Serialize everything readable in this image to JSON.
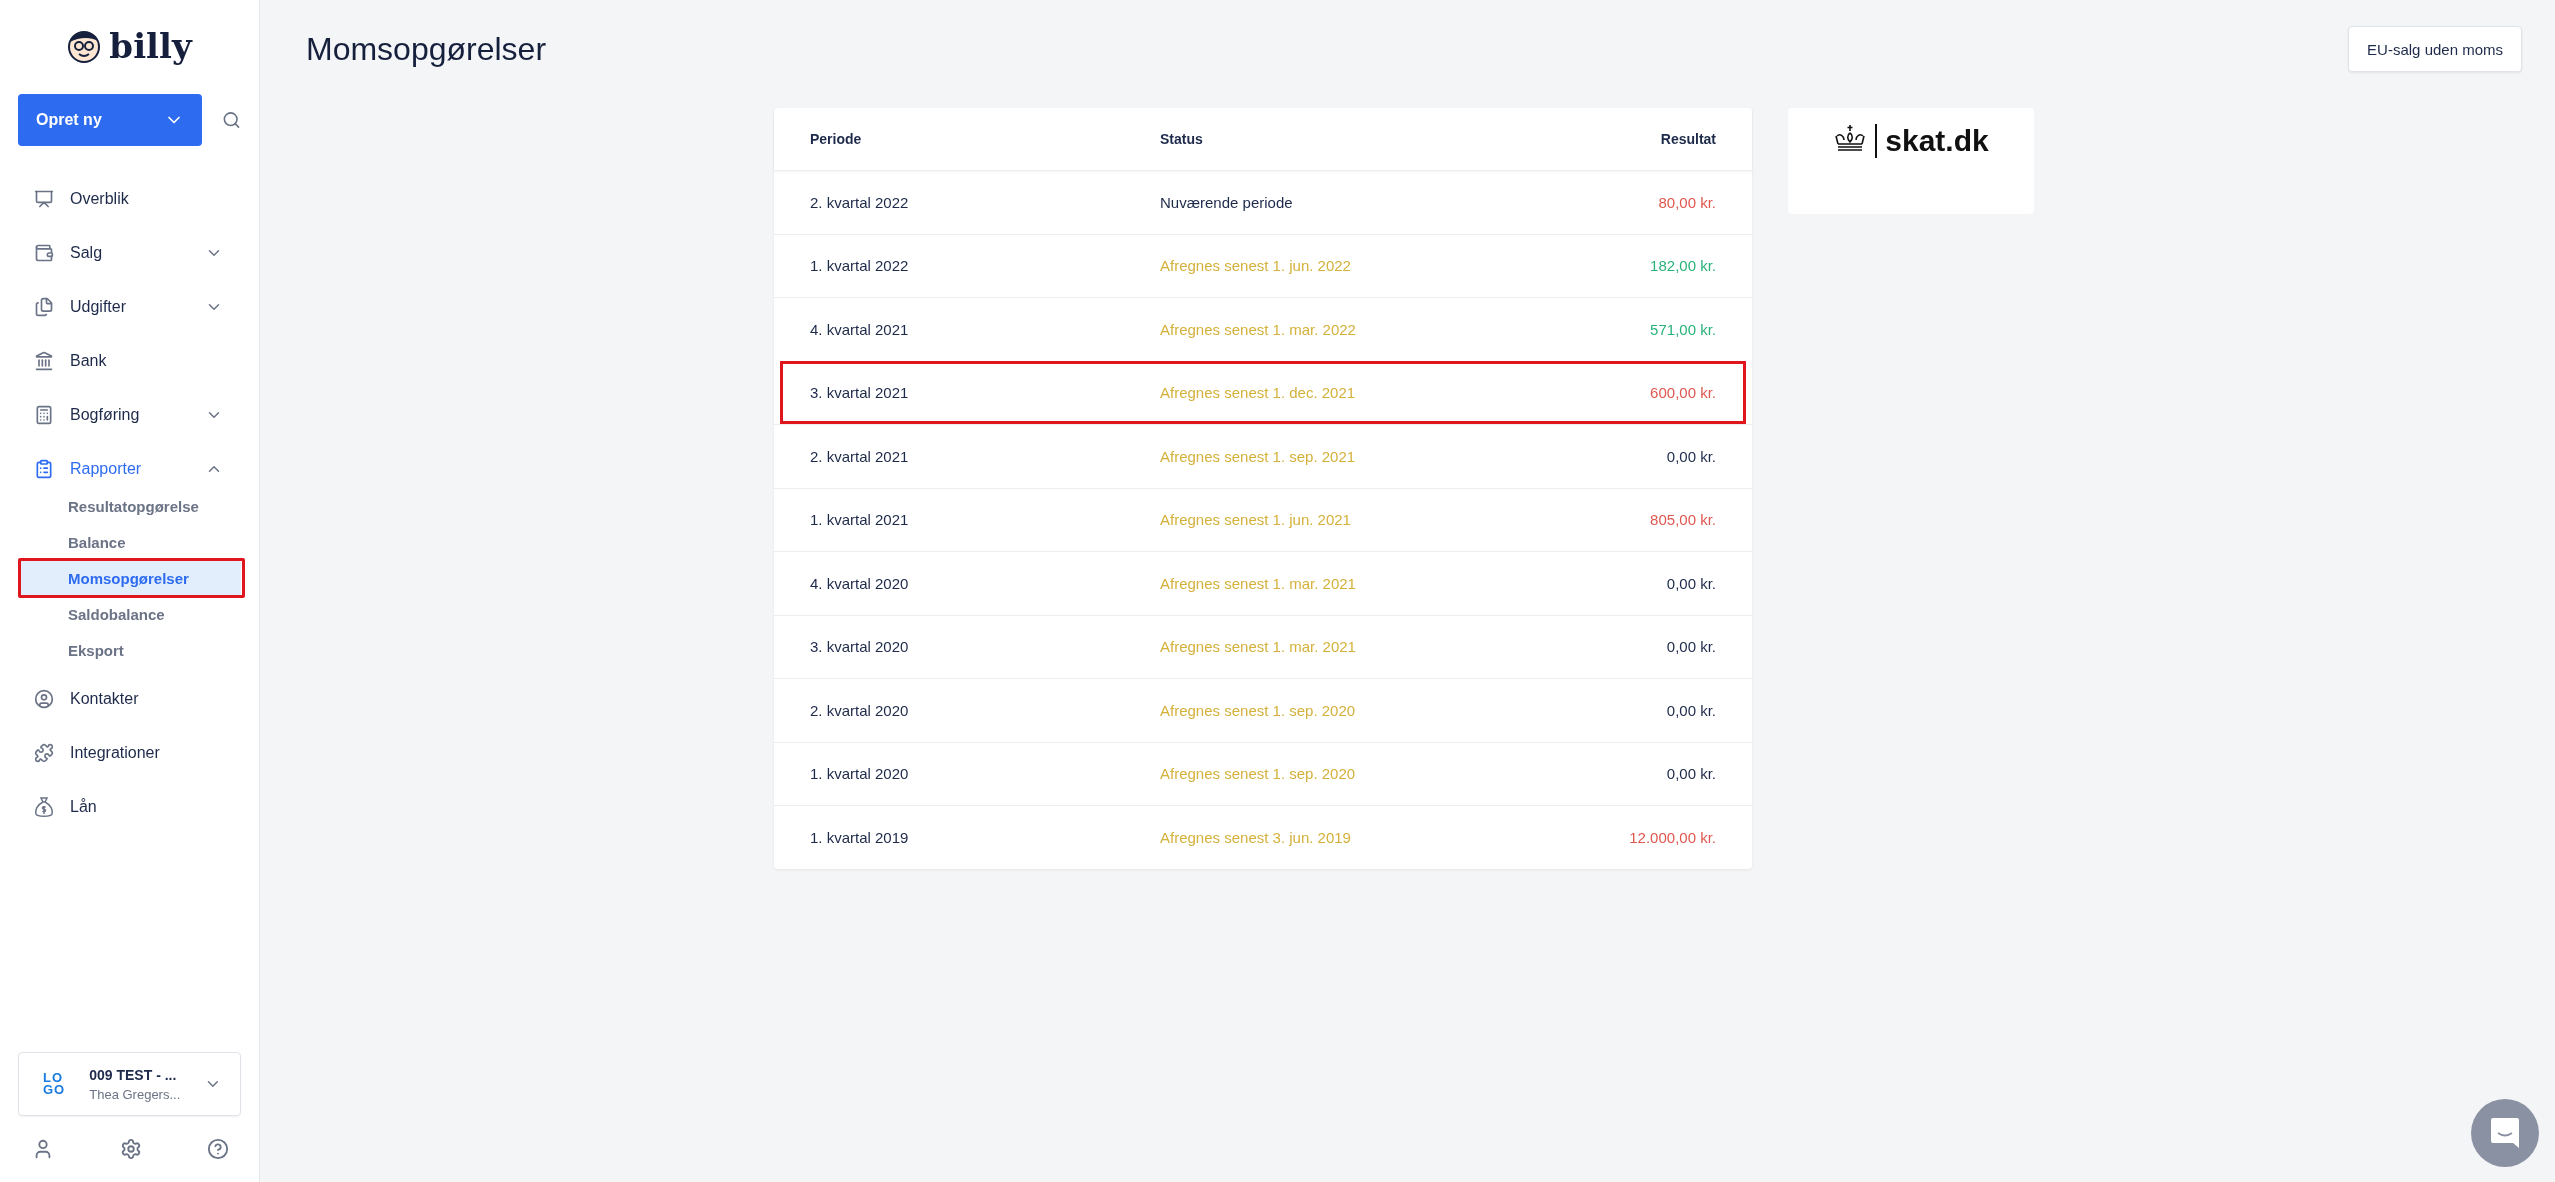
{
  "sidebar": {
    "brand": "billy",
    "create_button": "Opret ny",
    "items": [
      {
        "label": "Overblik",
        "selected": false
      },
      {
        "label": "Salg",
        "selected": false,
        "expanded": false
      },
      {
        "label": "Udgifter",
        "selected": false,
        "expanded": false
      },
      {
        "label": "Bank",
        "selected": false
      },
      {
        "label": "Bogføring",
        "selected": false,
        "expanded": false
      },
      {
        "label": "Rapporter",
        "selected": true,
        "expanded": true,
        "children": [
          {
            "label": "Resultatopgørelse",
            "selected": false,
            "highlighted": false
          },
          {
            "label": "Balance",
            "selected": false,
            "highlighted": false
          },
          {
            "label": "Momsopgørelser",
            "selected": true,
            "highlighted": true
          },
          {
            "label": "Saldobalance",
            "selected": false,
            "highlighted": false
          },
          {
            "label": "Eksport",
            "selected": false,
            "highlighted": false
          }
        ]
      },
      {
        "label": "Kontakter",
        "selected": false
      },
      {
        "label": "Integrationer",
        "selected": false
      },
      {
        "label": "Lån",
        "selected": false
      }
    ],
    "organization": {
      "logo_lines": [
        "LO",
        "GO"
      ],
      "name": "009 TEST - ...",
      "user": "Thea Gregers..."
    }
  },
  "page": {
    "title": "Momsopgørelser",
    "action_button": "EU-salg uden moms"
  },
  "table": {
    "columns": [
      "Periode",
      "Status",
      "Resultat"
    ],
    "rows": [
      {
        "period": "2. kvartal 2022",
        "status": {
          "text": "Nuværende periode",
          "color": "#1e2a4a"
        },
        "result": {
          "text": "80,00 kr.",
          "color": "#e0574f"
        },
        "highlighted": false
      },
      {
        "period": "1. kvartal 2022",
        "status": {
          "text": "Afregnes senest 1. jun. 2022",
          "color": "#d4b13a"
        },
        "result": {
          "text": "182,00 kr.",
          "color": "#28b27a"
        },
        "highlighted": false
      },
      {
        "period": "4. kvartal 2021",
        "status": {
          "text": "Afregnes senest 1. mar. 2022",
          "color": "#d4b13a"
        },
        "result": {
          "text": "571,00 kr.",
          "color": "#28b27a"
        },
        "highlighted": false
      },
      {
        "period": "3. kvartal 2021",
        "status": {
          "text": "Afregnes senest 1. dec. 2021",
          "color": "#d4b13a"
        },
        "result": {
          "text": "600,00 kr.",
          "color": "#e0574f"
        },
        "highlighted": true
      },
      {
        "period": "2. kvartal 2021",
        "status": {
          "text": "Afregnes senest 1. sep. 2021",
          "color": "#d4b13a"
        },
        "result": {
          "text": "0,00 kr.",
          "color": "#1e2a4a"
        },
        "highlighted": false
      },
      {
        "period": "1. kvartal 2021",
        "status": {
          "text": "Afregnes senest 1. jun. 2021",
          "color": "#d4b13a"
        },
        "result": {
          "text": "805,00 kr.",
          "color": "#e0574f"
        },
        "highlighted": false
      },
      {
        "period": "4. kvartal 2020",
        "status": {
          "text": "Afregnes senest 1. mar. 2021",
          "color": "#d4b13a"
        },
        "result": {
          "text": "0,00 kr.",
          "color": "#1e2a4a"
        },
        "highlighted": false
      },
      {
        "period": "3. kvartal 2020",
        "status": {
          "text": "Afregnes senest 1. mar. 2021",
          "color": "#d4b13a"
        },
        "result": {
          "text": "0,00 kr.",
          "color": "#1e2a4a"
        },
        "highlighted": false
      },
      {
        "period": "2. kvartal 2020",
        "status": {
          "text": "Afregnes senest 1. sep. 2020",
          "color": "#d4b13a"
        },
        "result": {
          "text": "0,00 kr.",
          "color": "#1e2a4a"
        },
        "highlighted": false
      },
      {
        "period": "1. kvartal 2020",
        "status": {
          "text": "Afregnes senest 1. sep. 2020",
          "color": "#d4b13a"
        },
        "result": {
          "text": "0,00 kr.",
          "color": "#1e2a4a"
        },
        "highlighted": false
      },
      {
        "period": "1. kvartal 2019",
        "status": {
          "text": "Afregnes senest 3. jun. 2019",
          "color": "#d4b13a"
        },
        "result": {
          "text": "12.000,00 kr.",
          "color": "#e0574f"
        },
        "highlighted": false
      }
    ]
  },
  "partner": {
    "name": "skat.dk"
  }
}
